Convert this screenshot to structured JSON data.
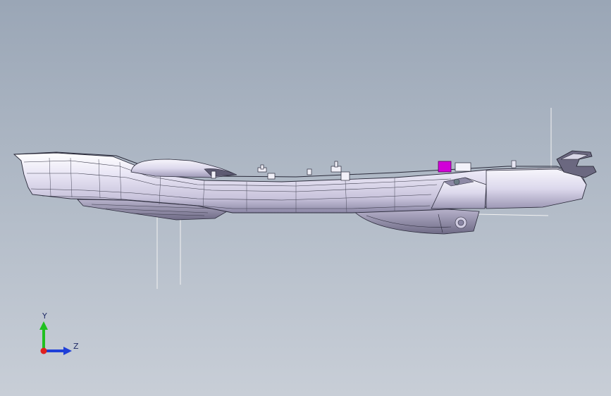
{
  "viewport": {
    "background_top": "#9aa6b6",
    "background_bottom": "#c8ced7"
  },
  "model": {
    "name": "side-view-cad-part",
    "shade_color": "#eceaf6",
    "edge_color": "#2a2a3a",
    "highlight_color": "#d100d8"
  },
  "triad": {
    "y_label": "Y",
    "z_label": "Z",
    "y_color": "#20c020",
    "z_color": "#1f3fd8",
    "x_color": "#e02020"
  }
}
